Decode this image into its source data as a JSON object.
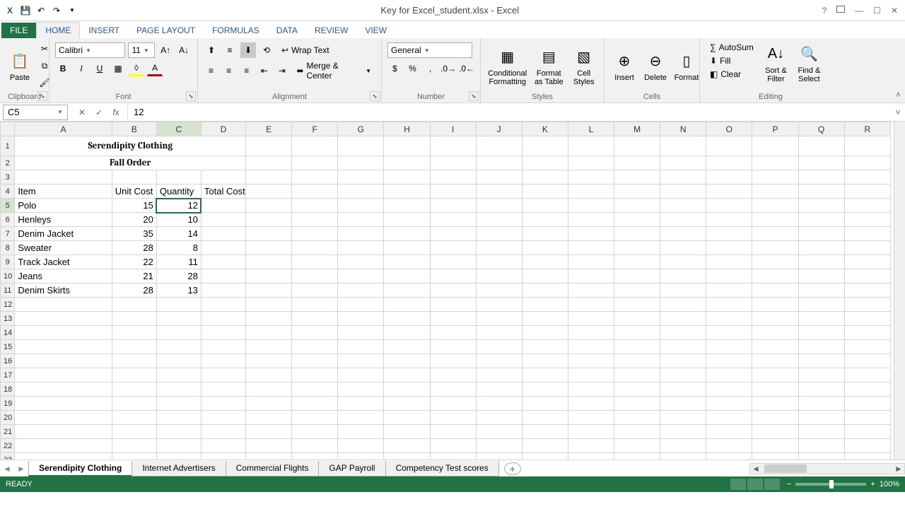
{
  "app": {
    "title": "Key for Excel_student.xlsx - Excel"
  },
  "tabs": {
    "file": "FILE",
    "items": [
      "HOME",
      "INSERT",
      "PAGE LAYOUT",
      "FORMULAS",
      "DATA",
      "REVIEW",
      "VIEW"
    ],
    "active": 0
  },
  "ribbon": {
    "clipboard": {
      "label": "Clipboard",
      "paste": "Paste"
    },
    "font": {
      "label": "Font",
      "name": "Calibri",
      "size": "11"
    },
    "alignment": {
      "label": "Alignment",
      "wrap": "Wrap Text",
      "merge": "Merge & Center"
    },
    "number": {
      "label": "Number",
      "format": "General"
    },
    "styles": {
      "label": "Styles",
      "conditional": "Conditional Formatting",
      "formatTable": "Format as Table",
      "cellStyles": "Cell Styles"
    },
    "cells": {
      "label": "Cells",
      "insert": "Insert",
      "delete": "Delete",
      "format": "Format"
    },
    "editing": {
      "label": "Editing",
      "autosum": "AutoSum",
      "fill": "Fill",
      "clear": "Clear",
      "sort": "Sort & Filter",
      "find": "Find & Select"
    }
  },
  "formulaBar": {
    "cellRef": "C5",
    "formula": "12"
  },
  "grid": {
    "columns": [
      "A",
      "B",
      "C",
      "D",
      "E",
      "F",
      "G",
      "H",
      "I",
      "J",
      "K",
      "L",
      "M",
      "N",
      "O",
      "P",
      "Q",
      "R"
    ],
    "selectedCol": "C",
    "selectedRow": 5,
    "title": "Serendipity Clothing",
    "subtitle": "Fall Order",
    "headers": {
      "item": "Item",
      "unitCost": "Unit Cost",
      "quantity": "Quantity",
      "totalCost": "Total Cost"
    },
    "rows": [
      {
        "item": "Polo",
        "unitCost": 15,
        "quantity": 12
      },
      {
        "item": "Henleys",
        "unitCost": 20,
        "quantity": 10
      },
      {
        "item": "Denim Jacket",
        "unitCost": 35,
        "quantity": 14
      },
      {
        "item": "Sweater",
        "unitCost": 28,
        "quantity": 8
      },
      {
        "item": "Track Jacket",
        "unitCost": 22,
        "quantity": 11
      },
      {
        "item": "Jeans",
        "unitCost": 21,
        "quantity": 28
      },
      {
        "item": "Denim Skirts",
        "unitCost": 28,
        "quantity": 13
      }
    ]
  },
  "sheets": {
    "items": [
      "Serendipity Clothing",
      "Internet Advertisers",
      "Commercial Flights",
      "GAP Payroll",
      "Competency Test scores"
    ],
    "active": 0
  },
  "status": {
    "mode": "READY",
    "zoom": "100%"
  }
}
